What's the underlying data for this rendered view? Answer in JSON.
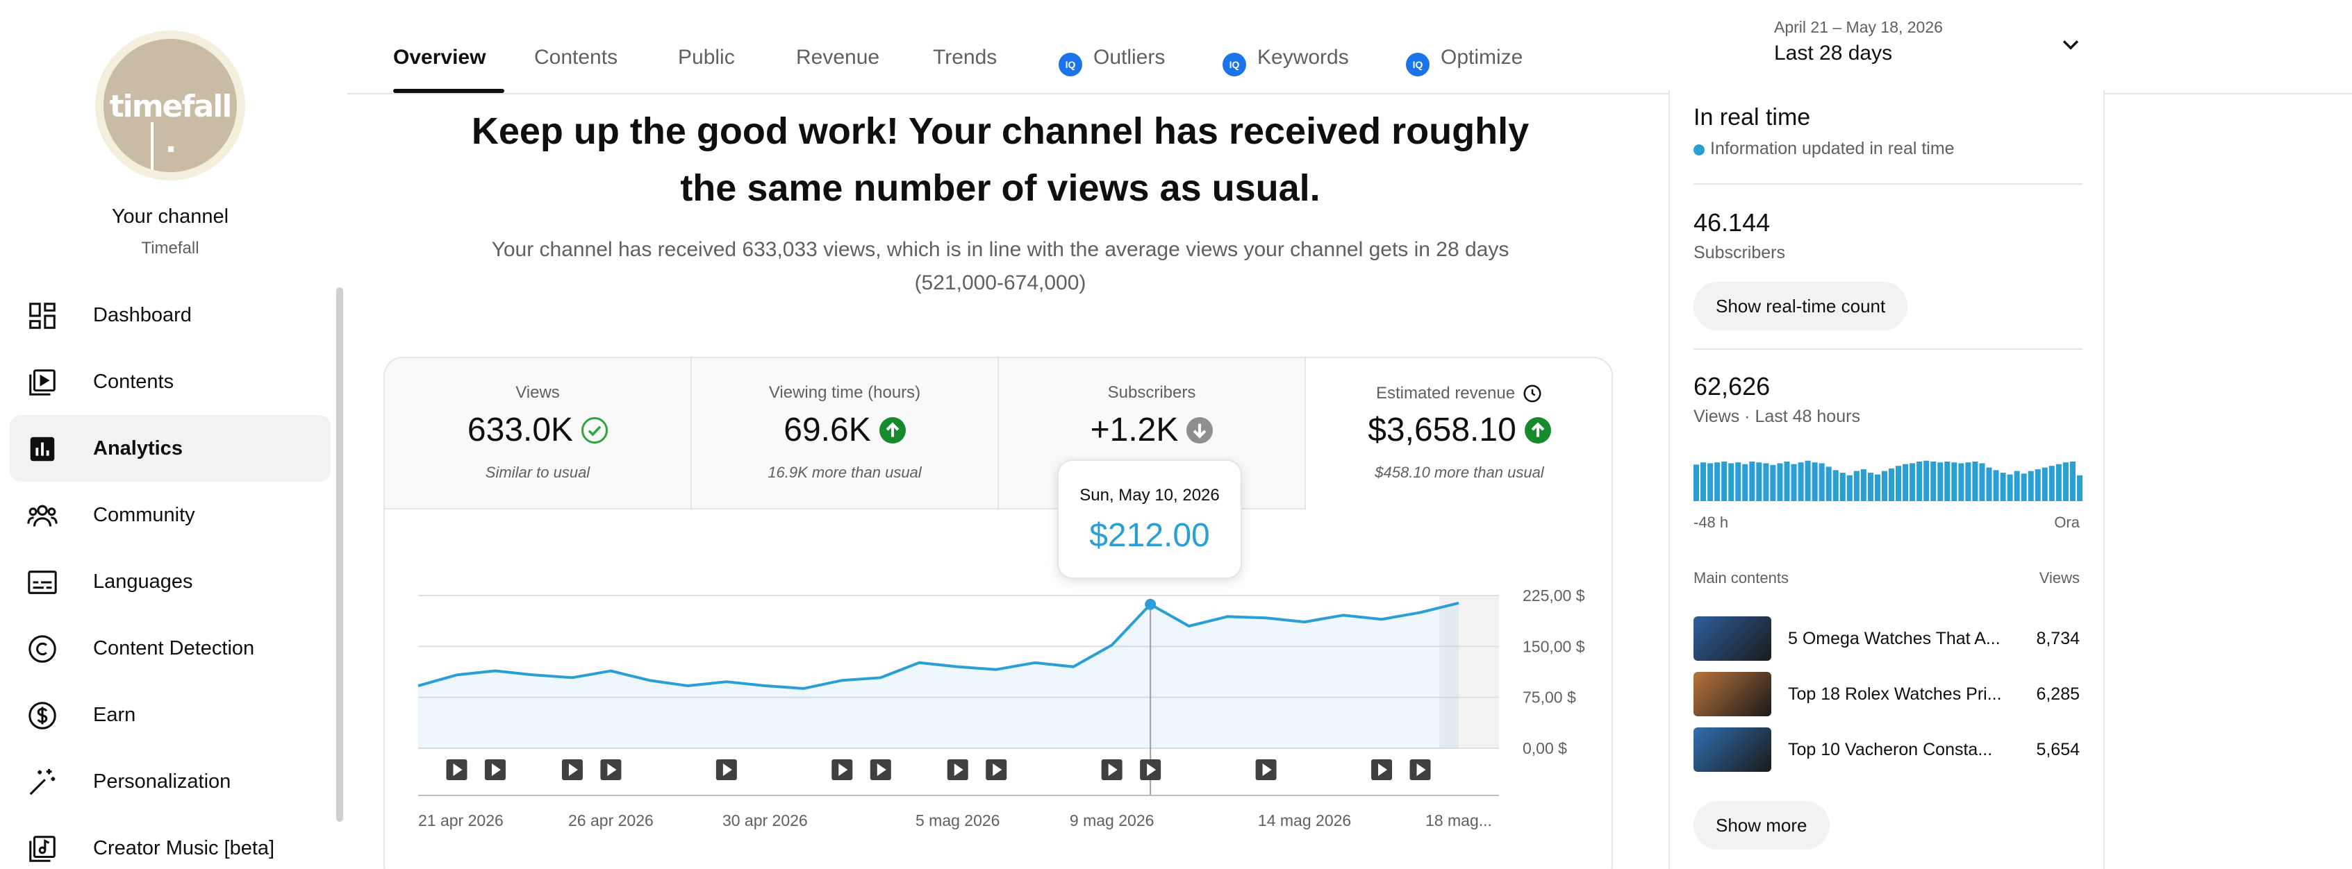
{
  "sidebar": {
    "avatar_text": "timefall .",
    "channel_title": "Your channel",
    "channel_name": "Timefall",
    "items": [
      {
        "label": "Dashboard",
        "icon": "dashboard-icon"
      },
      {
        "label": "Contents",
        "icon": "contents-icon"
      },
      {
        "label": "Analytics",
        "icon": "analytics-icon",
        "active": true
      },
      {
        "label": "Community",
        "icon": "community-icon"
      },
      {
        "label": "Languages",
        "icon": "languages-icon"
      },
      {
        "label": "Content Detection",
        "icon": "copyright-icon"
      },
      {
        "label": "Earn",
        "icon": "dollar-icon"
      },
      {
        "label": "Personalization",
        "icon": "magic-wand-icon"
      },
      {
        "label": "Creator Music [beta]",
        "icon": "music-icon"
      }
    ]
  },
  "tabs": [
    {
      "label": "Overview",
      "active": true
    },
    {
      "label": "Contents"
    },
    {
      "label": "Public"
    },
    {
      "label": "Revenue"
    },
    {
      "label": "Trends"
    },
    {
      "label": "Outliers",
      "badge": "IQ"
    },
    {
      "label": "Keywords",
      "badge": "IQ"
    },
    {
      "label": "Optimize",
      "badge": "IQ"
    }
  ],
  "date_picker": {
    "range": "April 21 – May 18, 2026",
    "label": "Last 28 days"
  },
  "headline": "Keep up the good work! Your channel has received roughly the same number of views as usual.",
  "subline": "Your channel has received 633,033 views, which is in line with the average views your channel gets in 28 days (521,000-674,000)",
  "metrics": [
    {
      "title": "Views",
      "value": "633.0K",
      "sub": "Similar to usual",
      "status": "check"
    },
    {
      "title": "Viewing time (hours)",
      "value": "69.6K",
      "sub": "16.9K more than usual",
      "status": "up"
    },
    {
      "title": "Subscribers",
      "value": "+1.2K",
      "sub": "",
      "status": "down"
    },
    {
      "title": "Estimated revenue",
      "value": "$3,658.10",
      "sub": "$458.10 more than usual",
      "status": "up"
    }
  ],
  "tooltip": {
    "date": "Sun, May 10, 2026",
    "value": "$212.00"
  },
  "chart_data": {
    "type": "area",
    "x": [
      "21 apr 2026",
      "22 apr 2026",
      "23 apr 2026",
      "24 apr 2026",
      "25 apr 2026",
      "26 apr 2026",
      "27 apr 2026",
      "28 apr 2026",
      "29 apr 2026",
      "30 apr 2026",
      "1 mag 2026",
      "2 mag 2026",
      "3 mag 2026",
      "4 mag 2026",
      "5 mag 2026",
      "6 mag 2026",
      "7 mag 2026",
      "8 mag 2026",
      "9 mag 2026",
      "10 mag 2026",
      "11 mag 2026",
      "12 mag 2026",
      "13 mag 2026",
      "14 mag 2026",
      "15 mag 2026",
      "16 mag 2026",
      "17 mag 2026",
      "18 mag 2026"
    ],
    "values": [
      92,
      108,
      114,
      108,
      104,
      114,
      100,
      92,
      98,
      92,
      88,
      100,
      104,
      126,
      120,
      116,
      126,
      120,
      152,
      212,
      180,
      194,
      192,
      186,
      196,
      190,
      200,
      214
    ],
    "x_tick_labels": [
      "21 apr 2026",
      "26 apr 2026",
      "30 apr 2026",
      "5 mag 2026",
      "9 mag 2026",
      "14 mag 2026",
      "18 mag..."
    ],
    "y_tick_labels": [
      "225,00 $",
      "150,00 $",
      "75,00 $",
      "0,00 $"
    ],
    "ylim": [
      0,
      225
    ],
    "video_markers": [
      "22 apr 2026",
      "23 apr 2026",
      "25 apr 2026",
      "26 apr 2026",
      "29 apr 2026",
      "2 mag 2026",
      "3 mag 2026",
      "5 mag 2026",
      "6 mag 2026",
      "9 mag 2026",
      "10 mag 2026",
      "13 mag 2026",
      "16 mag 2026",
      "17 mag 2026"
    ],
    "highlight": "10 mag 2026",
    "color": "#2a9fd6"
  },
  "realtime": {
    "title": "In real time",
    "info": "Information updated in real time",
    "subscribers_value": "46.144",
    "subscribers_label": "Subscribers",
    "show_realtime_btn": "Show real-time count",
    "views_value": "62,626",
    "views_label": "Views · Last 48 hours",
    "axis_left": "-48 h",
    "axis_right": "Ora",
    "bars": [
      0.85,
      0.9,
      0.88,
      0.9,
      0.92,
      0.88,
      0.9,
      0.86,
      0.92,
      0.9,
      0.88,
      0.84,
      0.88,
      0.92,
      0.86,
      0.9,
      0.94,
      0.9,
      0.88,
      0.8,
      0.72,
      0.66,
      0.6,
      0.7,
      0.74,
      0.66,
      0.62,
      0.7,
      0.76,
      0.82,
      0.86,
      0.88,
      0.92,
      0.94,
      0.92,
      0.9,
      0.92,
      0.9,
      0.88,
      0.9,
      0.92,
      0.88,
      0.78,
      0.72,
      0.66,
      0.62,
      0.7,
      0.64,
      0.7,
      0.74,
      0.78,
      0.82,
      0.86,
      0.9,
      0.92,
      0.6
    ],
    "main_contents_label": "Main contents",
    "views_col_label": "Views",
    "videos": [
      {
        "title": "5 Omega Watches That A...",
        "views": "8,734",
        "thumb_color": "#2e5f9e"
      },
      {
        "title": "Top 18 Rolex Watches Pri...",
        "views": "6,285",
        "thumb_color": "#b8733a"
      },
      {
        "title": "Top 10 Vacheron Consta...",
        "views": "5,654",
        "thumb_color": "#2f6fb0"
      }
    ],
    "show_more_btn": "Show more"
  }
}
